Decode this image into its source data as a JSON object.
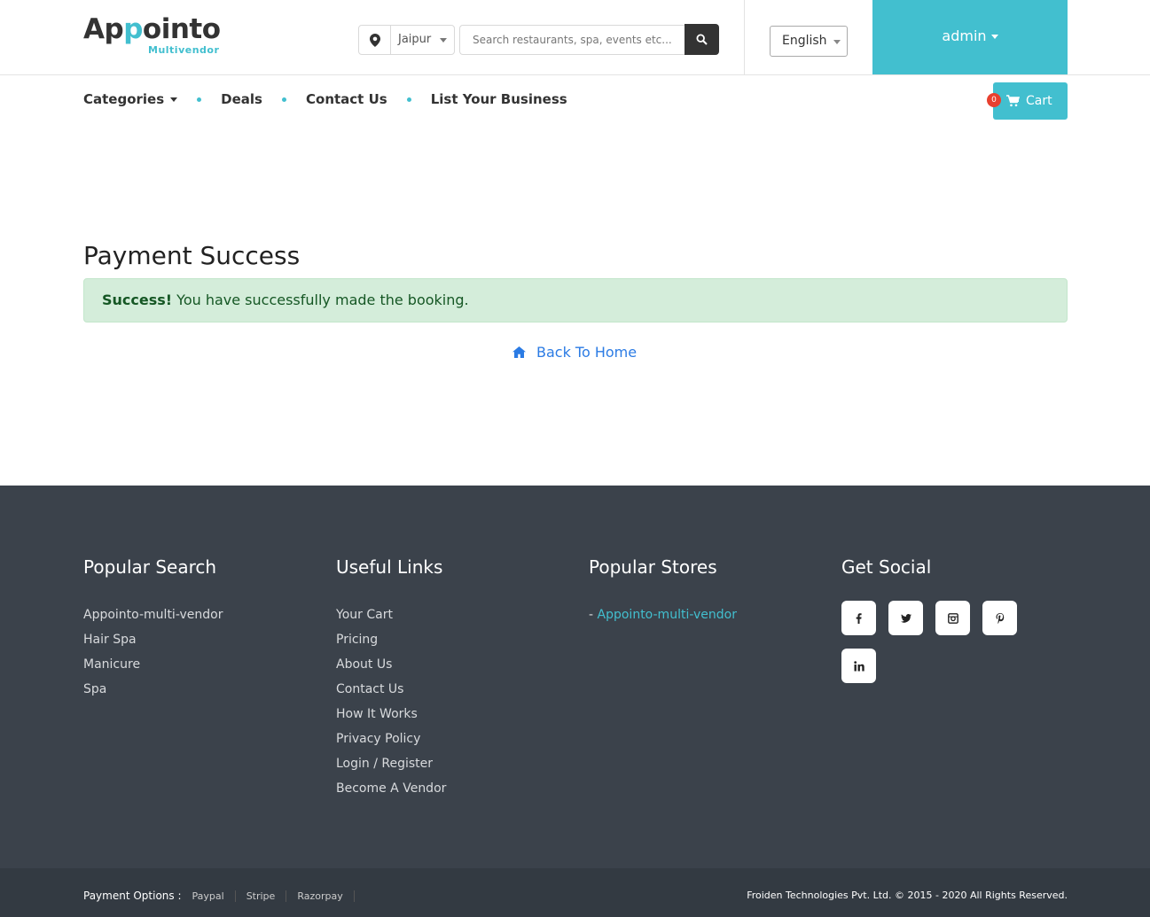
{
  "header": {
    "logo_main_pre": "Ap",
    "logo_main_accent": "p",
    "logo_main_post": "ointo",
    "logo_sub": "Multivendor",
    "location": "Jaipur",
    "search_placeholder": "Search restaurants, spa, events etc...",
    "language": "English",
    "user": "admin"
  },
  "nav": {
    "categories": "Categories",
    "deals": "Deals",
    "contact": "Contact Us",
    "list_business": "List Your Business",
    "cart_label": "Cart",
    "cart_count": "0"
  },
  "main": {
    "title": "Payment Success",
    "alert_strong": "Success!",
    "alert_text": " You have successfully made the booking.",
    "back_home": "Back To Home"
  },
  "footer": {
    "popular_search": {
      "title": "Popular Search",
      "items": [
        "Appointo-multi-vendor",
        "Hair Spa",
        "Manicure",
        "Spa"
      ]
    },
    "useful_links": {
      "title": "Useful Links",
      "items": [
        "Your Cart",
        "Pricing",
        "About Us",
        "Contact Us",
        "How It Works",
        "Privacy Policy",
        "Login / Register",
        "Become A Vendor"
      ]
    },
    "popular_stores": {
      "title": "Popular Stores",
      "prefix": "- ",
      "items": [
        "Appointo-multi-vendor"
      ]
    },
    "social": {
      "title": "Get Social",
      "icons": [
        "facebook-icon",
        "twitter-icon",
        "instagram-icon",
        "pinterest-icon",
        "linkedin-icon"
      ]
    },
    "payment_label": "Payment Options :",
    "payment_options": [
      "Paypal",
      "Stripe",
      "Razorpay"
    ],
    "copyright": "Froiden Technologies Pvt. Ltd. © 2015 - 2020 All Rights Reserved."
  },
  "colors": {
    "accent": "#42bfcf",
    "footer_bg": "#3b424b",
    "alert_bg": "#d4edda",
    "alert_text": "#155724",
    "link": "#2b7be4",
    "badge": "#e8402f"
  }
}
